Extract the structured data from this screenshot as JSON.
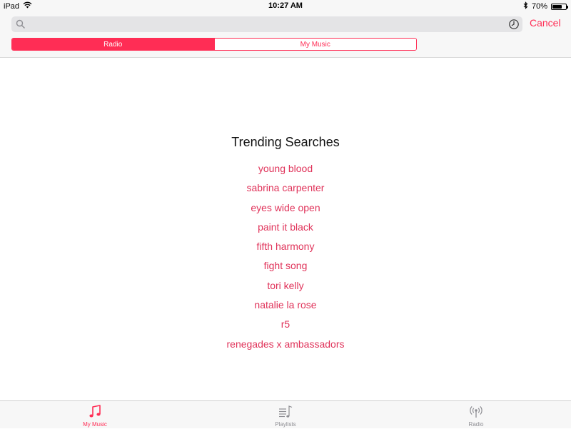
{
  "status_bar": {
    "device": "iPad",
    "time": "10:27 AM",
    "battery_percent": "70%",
    "battery_level": 0.7,
    "wifi_icon": "wifi-icon",
    "bluetooth_icon": "bluetooth-icon"
  },
  "search": {
    "value": "",
    "placeholder": "",
    "cancel_label": "Cancel"
  },
  "segments": {
    "radio": "Radio",
    "my_music": "My Music",
    "selected": "radio"
  },
  "trending": {
    "title": "Trending Searches",
    "items": [
      "young blood",
      "sabrina carpenter",
      "eyes wide open",
      "paint it black",
      "fifth harmony",
      "fight song",
      "tori kelly",
      "natalie la rose",
      "r5",
      "renegades x ambassadors"
    ]
  },
  "tabs": [
    {
      "label": "My Music",
      "icon": "music-note-icon",
      "active": true
    },
    {
      "label": "Playlists",
      "icon": "playlist-icon",
      "active": false
    },
    {
      "label": "Radio",
      "icon": "radio-broadcast-icon",
      "active": false
    }
  ],
  "colors": {
    "accent": "#ff2d55",
    "link": "#e0335a",
    "bar_background": "#f7f7f7",
    "inactive_tab": "#8e8e93"
  }
}
